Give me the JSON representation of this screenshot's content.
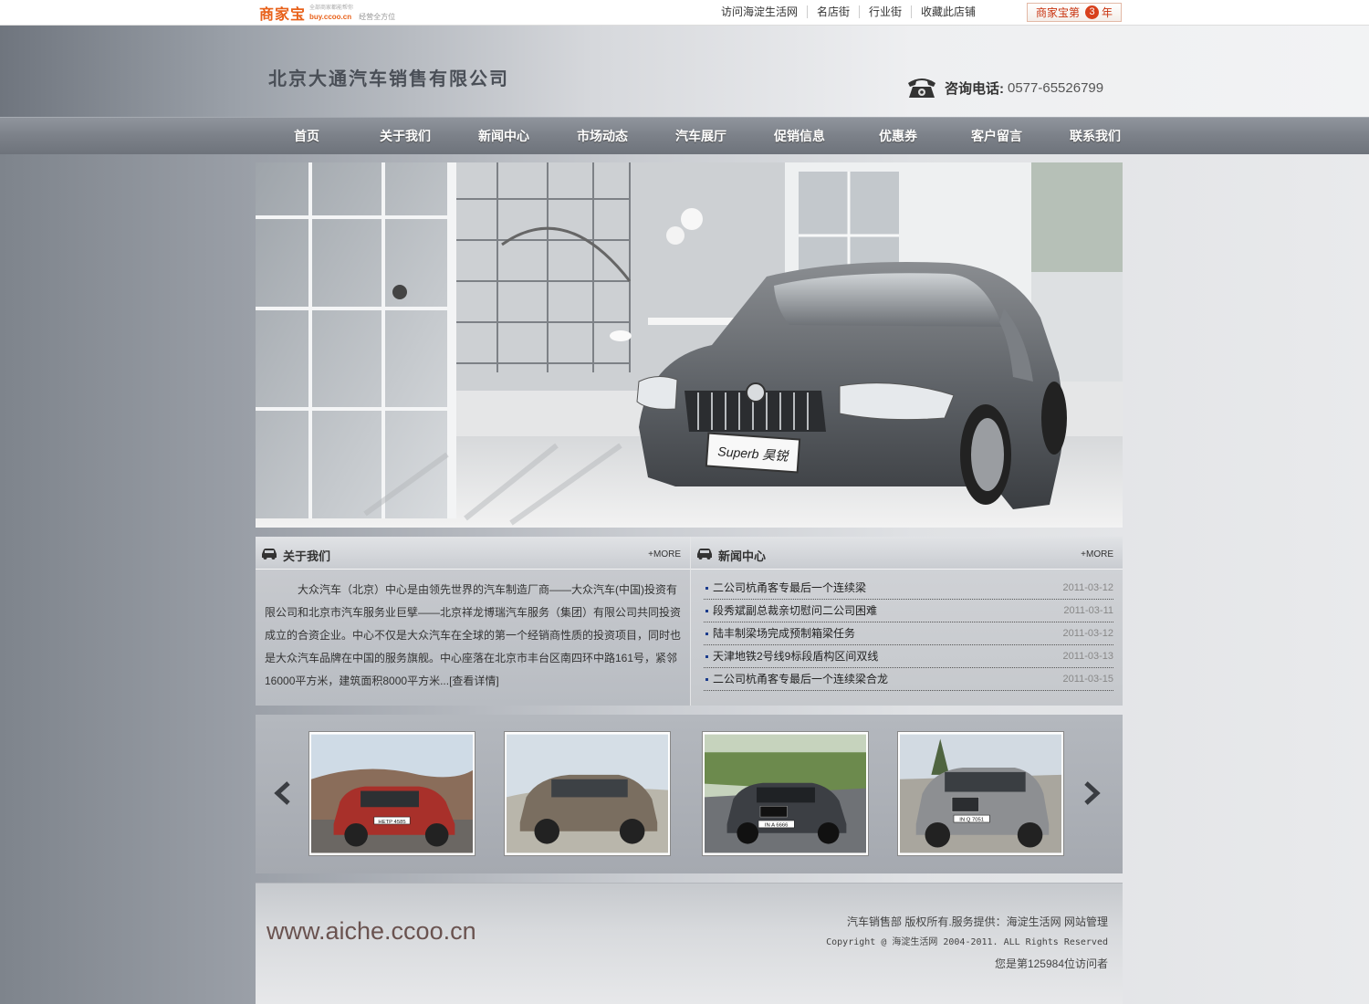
{
  "topbar": {
    "logo_text": "商家宝",
    "logo_tagline": "全部商家都能帮你",
    "logo_domain": "buy.ccoo.cn",
    "logo_note": "经营全方位",
    "links": [
      "访问海淀生活网",
      "名店街",
      "行业街",
      "收藏此店铺"
    ],
    "years_prefix": "商家宝第",
    "years_num": "3",
    "years_suffix": "年"
  },
  "header": {
    "company_name": "北京大通汽车销售有限公司",
    "phone_label": "咨询电话:",
    "phone_number": "0577-65526799",
    "phone_icon": "telephone-icon"
  },
  "nav": {
    "items": [
      "首页",
      "关于我们",
      "新闻中心",
      "市场动态",
      "汽车展厅",
      "促销信息",
      "优惠券",
      "客户留言",
      "联系我们"
    ]
  },
  "banner": {
    "plate_text": "Superb 昊锐"
  },
  "about": {
    "title": "关于我们",
    "more": "+MORE",
    "icon": "car-icon",
    "text": "大众汽车（北京）中心是由领先世界的汽车制造厂商——大众汽车(中国)投资有限公司和北京市汽车服务业巨擘——北京祥龙博瑞汽车服务（集团）有限公司共同投资成立的合资企业。中心不仅是大众汽车在全球的第一个经销商性质的投资项目，同时也是大众汽车品牌在中国的服务旗舰。中心座落在北京市丰台区南四环中路161号，紧邻16000平方米，建筑面积8000平方米...[查看详情]"
  },
  "news": {
    "title": "新闻中心",
    "more": "+MORE",
    "icon": "car-icon",
    "items": [
      {
        "title": "二公司杭甬客专最后一个连续梁",
        "date": "2011-03-12"
      },
      {
        "title": "段秀斌副总裁亲切慰问二公司困难",
        "date": "2011-03-11"
      },
      {
        "title": "陆丰制梁场完成预制箱梁任务",
        "date": "2011-03-12"
      },
      {
        "title": "天津地铁2号线9标段盾构区间双线",
        "date": "2011-03-13"
      },
      {
        "title": "二公司杭甬客专最后一个连续梁合龙",
        "date": "2011-03-15"
      }
    ]
  },
  "gallery": {
    "prev_icon": "chevron-left-icon",
    "next_icon": "chevron-right-icon",
    "cars": [
      {
        "plate": "HETP 4585",
        "color": "#a8302a"
      },
      {
        "plate": "",
        "color": "#7a6e60"
      },
      {
        "plate": "IN A 6666",
        "color": "#3c3f44"
      },
      {
        "plate": "IN Q 7051",
        "color": "#8d8f92"
      }
    ]
  },
  "footer": {
    "url": "www.aiche.ccoo.cn",
    "line1": "汽车销售部 版权所有.服务提供：海淀生活网 网站管理",
    "line2": "Copyright @ 海淀生活网 2004-2011. ALL Rights Reserved",
    "line3": "您是第125984位访问者"
  }
}
